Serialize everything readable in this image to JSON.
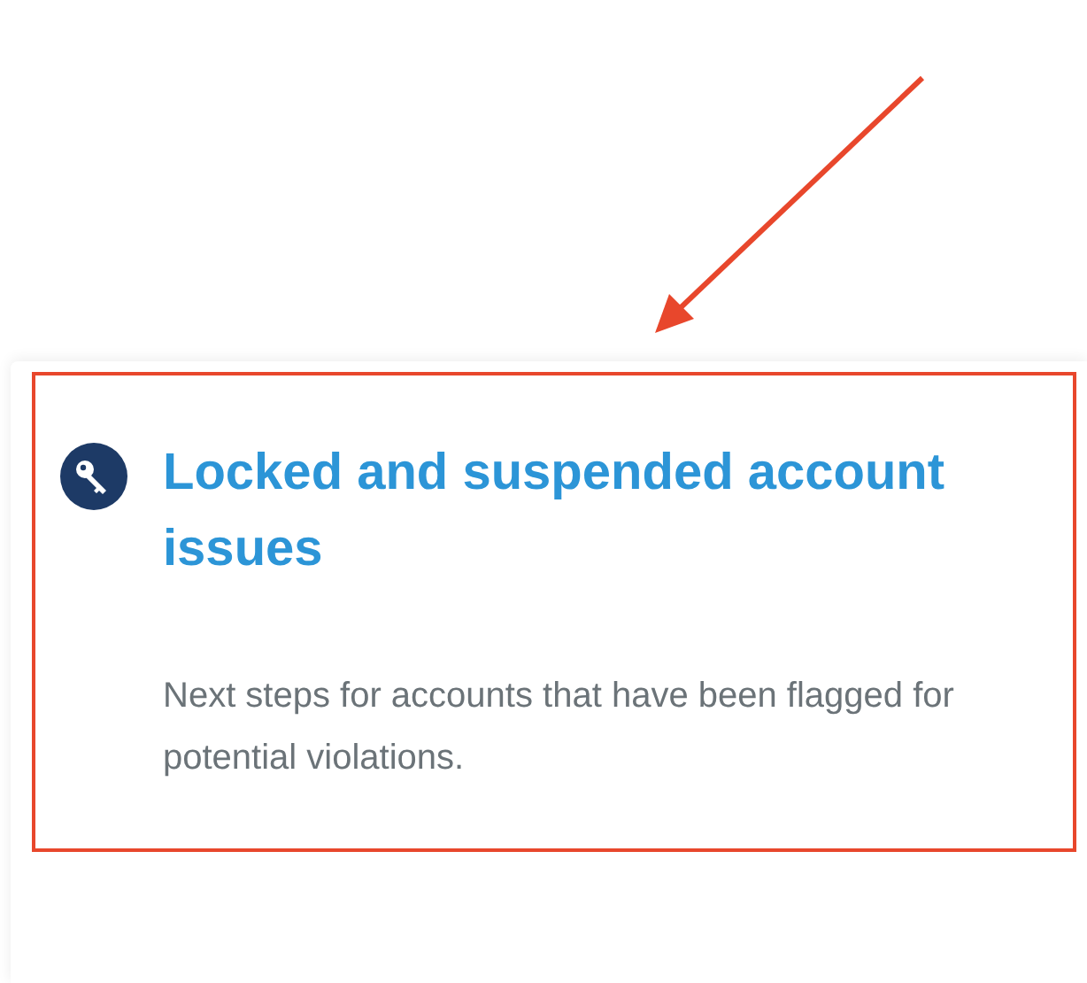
{
  "card": {
    "title": "Locked and suspended account issues",
    "description": "Next steps for accounts that have been flagged for potential violations."
  }
}
